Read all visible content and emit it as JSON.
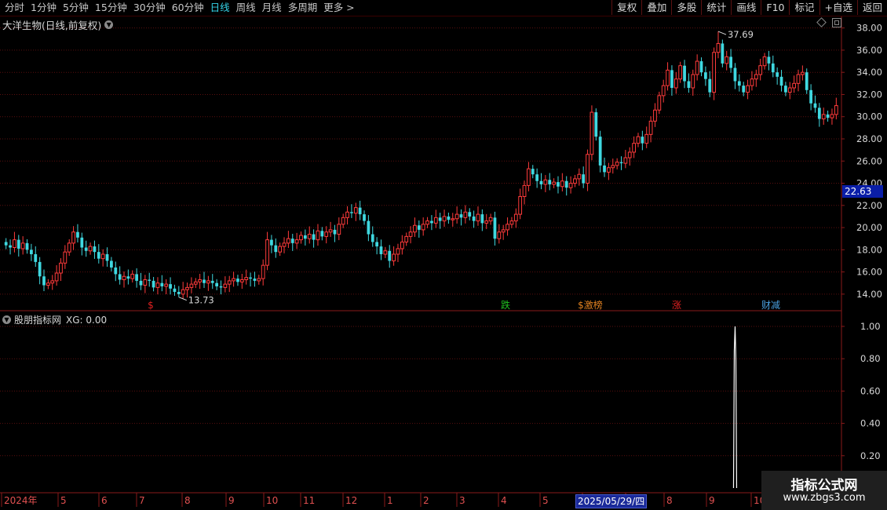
{
  "toolbar": {
    "left_items": [
      {
        "label": "分时",
        "active": false
      },
      {
        "label": "1分钟",
        "active": false
      },
      {
        "label": "5分钟",
        "active": false
      },
      {
        "label": "15分钟",
        "active": false
      },
      {
        "label": "30分钟",
        "active": false
      },
      {
        "label": "60分钟",
        "active": false
      },
      {
        "label": "日线",
        "active": true
      },
      {
        "label": "周线",
        "active": false
      },
      {
        "label": "月线",
        "active": false
      },
      {
        "label": "多周期",
        "active": false
      },
      {
        "label": "更多 >",
        "active": false
      }
    ],
    "right_buttons": [
      "复权",
      "叠加",
      "多股",
      "统计",
      "画线",
      "F10",
      "标记",
      "+自选",
      "返回"
    ]
  },
  "main_chart": {
    "title": "大洋生物(日线,前复权)",
    "y_ticks": [
      "38.00",
      "36.00",
      "34.00",
      "32.00",
      "30.00",
      "28.00",
      "26.00",
      "24.00",
      "22.00",
      "20.00",
      "18.00",
      "16.00",
      "14.00"
    ],
    "high_label": "37.69",
    "low_label": "13.73",
    "current_price": "22.63",
    "event_markers": [
      {
        "text": "$",
        "color": "#e02020"
      },
      {
        "text": "跌",
        "color": "#20c020"
      },
      {
        "text": "$激榜",
        "color": "#e08020"
      },
      {
        "text": "涨",
        "color": "#e02020"
      },
      {
        "text": "财减",
        "color": "#4aa0e0"
      }
    ]
  },
  "indicator": {
    "title": "股朋指标网",
    "xg_label": "XG: 0.00",
    "y_ticks": [
      "1.00",
      "0.80",
      "0.60",
      "0.40",
      "0.20"
    ]
  },
  "x_axis": {
    "labels": [
      "2024年",
      "5",
      "6",
      "7",
      "8",
      "9",
      "10",
      "11",
      "12",
      "1",
      "2",
      "3",
      "4",
      "5",
      "6",
      "7",
      "8",
      "9",
      "10"
    ],
    "cursor_date": "2025/05/29/四"
  },
  "watermark": {
    "title": "指标公式网",
    "url": "www.zbgs3.com"
  },
  "colors": {
    "up": "#ff3b3b",
    "down": "#3fd8e0",
    "grid": "#5a0f0f",
    "axis": "#8a1a1a"
  },
  "chart_data": {
    "type": "candlestick",
    "ylim": [
      13.0,
      38.4
    ],
    "close": [
      18.4,
      18.2,
      18.9,
      18.1,
      18.6,
      18.0,
      17.6,
      16.9,
      15.6,
      14.8,
      15.0,
      15.2,
      15.9,
      16.8,
      17.8,
      18.6,
      19.6,
      19.1,
      18.2,
      17.9,
      18.3,
      17.8,
      17.2,
      17.6,
      17.0,
      16.4,
      15.8,
      15.3,
      15.6,
      15.4,
      15.8,
      15.2,
      14.8,
      15.3,
      15.2,
      14.6,
      15.0,
      14.7,
      14.9,
      14.5,
      14.2,
      14.0,
      14.4,
      14.6,
      14.9,
      15.1,
      15.3,
      15.0,
      15.2,
      15.0,
      14.7,
      14.6,
      14.9,
      15.2,
      15.4,
      15.1,
      15.3,
      15.5,
      15.4,
      15.2,
      15.4,
      16.6,
      18.9,
      18.4,
      17.8,
      18.3,
      18.6,
      19.0,
      18.6,
      18.9,
      19.3,
      19.0,
      19.4,
      18.9,
      19.7,
      19.2,
      19.6,
      19.8,
      19.4,
      20.3,
      20.9,
      21.4,
      21.3,
      21.8,
      21.2,
      20.6,
      19.4,
      18.7,
      18.3,
      17.6,
      17.9,
      17.0,
      17.6,
      18.1,
      18.7,
      19.2,
      19.6,
      20.2,
      19.8,
      20.3,
      20.6,
      20.4,
      20.9,
      20.6,
      21.0,
      20.7,
      20.8,
      21.2,
      20.9,
      21.4,
      21.0,
      20.6,
      21.2,
      20.4,
      20.6,
      20.9,
      19.0,
      19.6,
      19.8,
      20.3,
      20.6,
      21.2,
      22.8,
      23.8,
      25.3,
      24.8,
      24.2,
      23.9,
      24.3,
      23.9,
      24.1,
      23.7,
      24.2,
      23.6,
      24.0,
      24.4,
      24.8,
      24.0,
      26.6,
      30.4,
      28.2,
      25.6,
      25.0,
      25.4,
      25.6,
      25.9,
      25.8,
      26.3,
      26.8,
      27.6,
      28.2,
      27.6,
      28.4,
      29.6,
      30.6,
      31.9,
      32.8,
      34.2,
      32.6,
      33.4,
      34.6,
      33.2,
      32.6,
      33.8,
      35.0,
      34.0,
      33.4,
      32.2,
      35.8,
      36.6,
      34.8,
      35.4,
      34.4,
      33.2,
      32.8,
      32.2,
      32.8,
      33.4,
      33.8,
      34.6,
      35.4,
      34.8,
      34.0,
      33.6,
      32.8,
      32.2,
      32.6,
      33.0,
      33.8,
      34.0,
      32.4,
      31.2,
      30.8,
      29.8,
      30.2,
      29.9,
      30.2,
      31.0
    ],
    "xg_signal_index": 173
  }
}
